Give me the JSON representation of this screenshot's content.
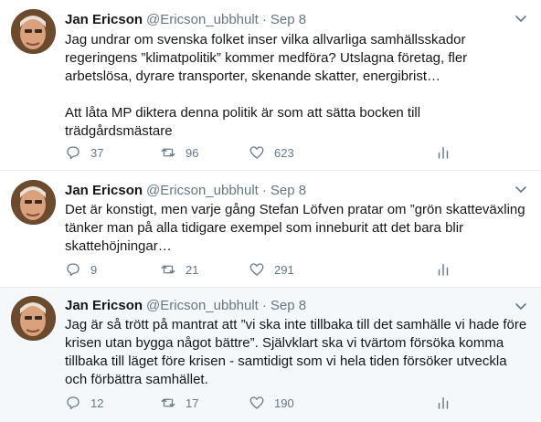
{
  "tweets": [
    {
      "name": "Jan Ericson",
      "handle": "@Ericson_ubbhult",
      "separator": "·",
      "date": "Sep 8",
      "lines": [
        "Jag undrar om svenska folket inser vilka allvarliga samhällsskador",
        "regeringens ”klimatpolitik” kommer medföra? Utslagna företag, fler",
        "arbetslösa, dyrare transporter, skenande skatter, energibrist…",
        "",
        "Att låta MP diktera denna politik är som att sätta bocken till",
        "trädgårdsmästare"
      ],
      "replies": "37",
      "retweets": "96",
      "likes": "623"
    },
    {
      "name": "Jan Ericson",
      "handle": "@Ericson_ubbhult",
      "separator": "·",
      "date": "Sep 8",
      "lines": [
        "Det är konstigt, men varje gång Stefan Löfven pratar om ”grön skatteväxling",
        "tänker man på alla tidigare exempel som inneburit att det bara blir",
        "skattehöjningar…"
      ],
      "replies": "9",
      "retweets": "21",
      "likes": "291"
    },
    {
      "name": "Jan Ericson",
      "handle": "@Ericson_ubbhult",
      "separator": "·",
      "date": "Sep 8",
      "lines": [
        "Jag är så trött på mantrat att ”vi ska inte tillbaka till det samhälle vi hade före",
        "krisen utan bygga något bättre”. Självklart ska vi tvärtom försöka komma",
        "tillbaka till läget före krisen - samtidigt som vi hela tiden försöker utveckla",
        "och förbättra samhället."
      ],
      "replies": "12",
      "retweets": "17",
      "likes": "190"
    }
  ],
  "colors": {
    "text": "#14171a",
    "secondary": "#657786",
    "border": "#e6ecf0",
    "highlight_bg": "#f5f8fa"
  },
  "icons": {
    "reply": "reply-icon",
    "retweet": "retweet-icon",
    "like": "heart-icon",
    "stats": "analytics-icon",
    "menu": "chevron-down-icon"
  }
}
